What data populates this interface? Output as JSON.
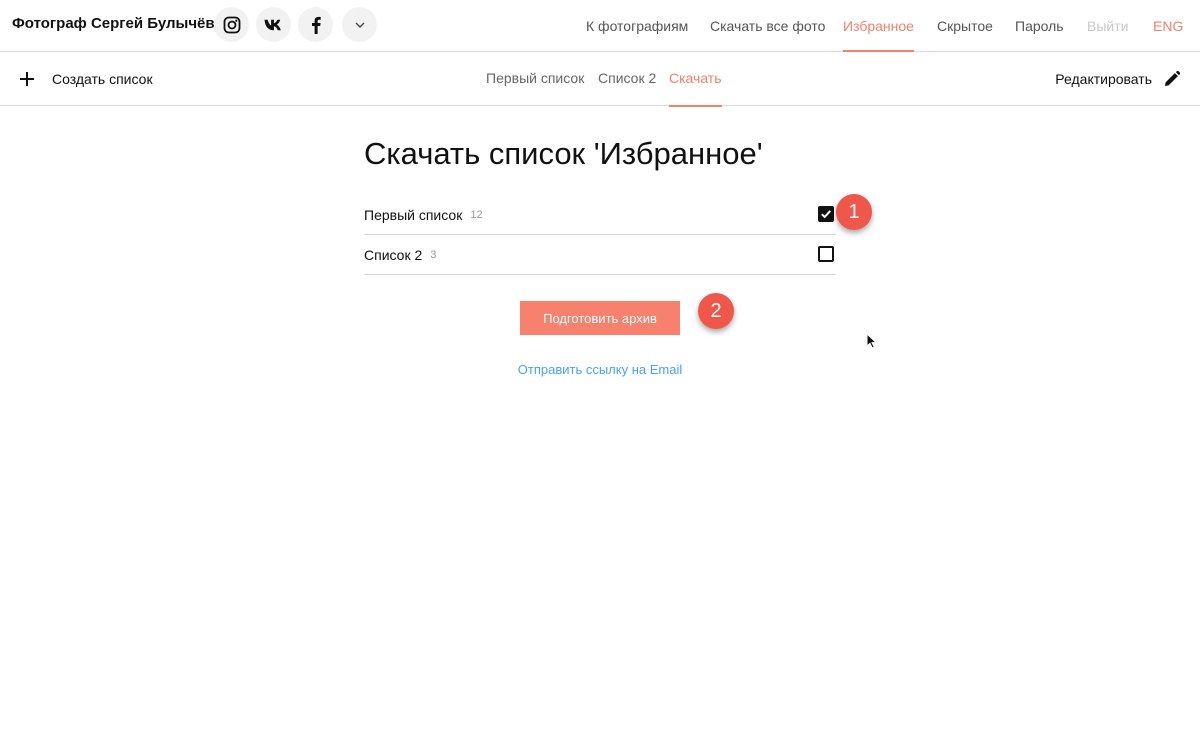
{
  "header": {
    "brand": "Фотограф Сергей Булычёв",
    "social": [
      {
        "icon": "instagram-icon"
      },
      {
        "icon": "vk-icon"
      },
      {
        "icon": "facebook-icon"
      },
      {
        "icon": "chevron-down-icon"
      }
    ],
    "nav": [
      {
        "label": "К фотографиям",
        "state": "normal"
      },
      {
        "label": "Скачать все фото",
        "state": "normal"
      },
      {
        "label": "Избранное",
        "state": "active"
      },
      {
        "label": "Скрытое",
        "state": "normal"
      },
      {
        "label": "Пароль",
        "state": "normal"
      },
      {
        "label": "Выйти",
        "state": "disabled"
      },
      {
        "label": "ENG",
        "state": "lang"
      }
    ]
  },
  "toolbar": {
    "create_label": "Создать список",
    "tabs": [
      {
        "label": "Первый список",
        "active": false
      },
      {
        "label": "Список 2",
        "active": false
      },
      {
        "label": "Скачать",
        "active": true
      }
    ],
    "edit_label": "Редактировать"
  },
  "main": {
    "title": "Скачать список 'Избранное'",
    "lists": [
      {
        "name": "Первый список",
        "count": "12",
        "checked": true
      },
      {
        "name": "Список 2",
        "count": "3",
        "checked": false
      }
    ],
    "prepare_button": "Подготовить архив",
    "email_link": "Отправить ссылку на Email"
  },
  "markers": [
    "1",
    "2"
  ],
  "colors": {
    "accent": "#f2826a",
    "button": "#f8816d",
    "link": "#4aa3e8",
    "marker": "#f0574b"
  }
}
